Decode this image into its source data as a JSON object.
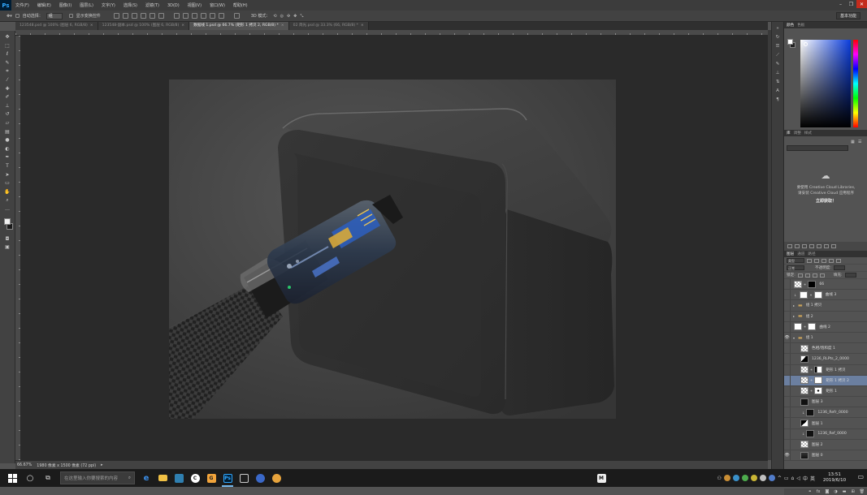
{
  "menubar": {
    "logo": "Ps",
    "items": [
      "文件(F)",
      "编辑(E)",
      "图像(I)",
      "图层(L)",
      "文字(Y)",
      "选择(S)",
      "滤镜(T)",
      "3D(D)",
      "视图(V)",
      "窗口(W)",
      "帮助(H)"
    ]
  },
  "options": {
    "auto_select": "自动选择：",
    "auto_select_value": "组",
    "show_transform": "显示变换控件",
    "mode_3d": "3D 模式：",
    "workspace": "基本功能"
  },
  "tabs": [
    {
      "label": "123548.psd @ 100% (图层 6, RGB/8)"
    },
    {
      "label": "123548-副本.psd @ 100% (图层 6, RGB/8)"
    },
    {
      "label": "数据线 1.psd @ 66.7% (矩形 1 拷贝 2, RGB/8) *"
    },
    {
      "label": "02 简光.psd @ 33.3% (66, RGB/8) *"
    }
  ],
  "active_tab": 2,
  "status": {
    "zoom": "66.67%",
    "doc_size": "1980 像素 x 1500 像素 (72 ppi)"
  },
  "panels": {
    "color_tabs": [
      "颜色",
      "色板"
    ],
    "library_tabs": [
      "库",
      "调整",
      "样式"
    ],
    "library_message_1": "要使用 Creative Cloud Libraries,",
    "library_message_2": "请安装 Creative Cloud 应用程序",
    "library_link": "立即获取！",
    "layers_tabs": [
      "图层",
      "通道",
      "路径"
    ],
    "kind_label": "类型",
    "blend_mode": "正常",
    "opacity_label": "不透明度:",
    "opacity_value": "",
    "lock_label": "锁定:",
    "fill_label": "填充:"
  },
  "layers": [
    {
      "name": "66",
      "visible": false,
      "type": "smart"
    },
    {
      "name": "曲线 3",
      "visible": false,
      "type": "adjust"
    },
    {
      "name": "组 1 拷贝",
      "visible": false,
      "type": "group"
    },
    {
      "name": "组 2",
      "visible": false,
      "type": "group"
    },
    {
      "name": "曲线 2",
      "visible": false,
      "type": "adjust"
    },
    {
      "name": "组 1",
      "visible": true,
      "type": "group-open"
    },
    {
      "name": "色相/饱和度 1",
      "visible": false,
      "type": "adjust"
    },
    {
      "name": "1236_RLPts_2_0000",
      "visible": false,
      "type": "image"
    },
    {
      "name": "矩形 1 拷贝",
      "visible": false,
      "type": "shape"
    },
    {
      "name": "矩形 1 拷贝 2",
      "visible": false,
      "type": "shape",
      "selected": true
    },
    {
      "name": "矩形 1",
      "visible": false,
      "type": "shape"
    },
    {
      "name": "图层 3",
      "visible": false,
      "type": "image"
    },
    {
      "name": "1236_Refr_0000",
      "visible": false,
      "type": "image-mask"
    },
    {
      "name": "图层 1",
      "visible": false,
      "type": "image"
    },
    {
      "name": "1236_Ref_0000",
      "visible": false,
      "type": "image-mask"
    },
    {
      "name": "图层 2",
      "visible": false,
      "type": "image"
    },
    {
      "name": "图层 0",
      "visible": true,
      "type": "image"
    }
  ],
  "taskbar": {
    "search_placeholder": "在这里输入你要搜索的内容",
    "time": "13:51",
    "date": "2019/6/10",
    "ime": "中",
    "ime2": "英"
  },
  "colors": {
    "accent": "#31a8ff",
    "selected_layer": "#6b7fa0",
    "taskbar": "#1b1b1b"
  }
}
